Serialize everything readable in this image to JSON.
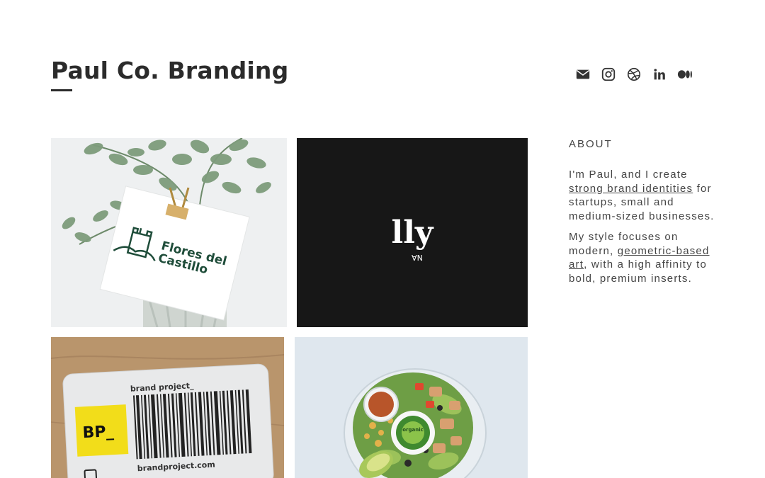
{
  "header": {
    "title": "Paul Co. Branding",
    "social_icons": [
      "envelope-icon",
      "instagram-icon",
      "dribbble-icon",
      "linkedin-icon",
      "medium-icon"
    ]
  },
  "portfolio": {
    "tiles": [
      {
        "name": "flores-del-castillo",
        "text": "Flores del Castillo"
      },
      {
        "name": "lly",
        "text": "lly",
        "subtext": "NA"
      },
      {
        "name": "brand-project",
        "label": "brand project_",
        "badge": "BP_",
        "url": "brandproject.com"
      },
      {
        "name": "salad-bowl",
        "label": "organic"
      }
    ]
  },
  "about": {
    "heading": "ABOUT",
    "p1_before": "I'm Paul, and I create ",
    "p1_link": "strong brand identities",
    "p1_after": " for startups, small and medium-sized businesses.",
    "p2_before": "My style focuses on modern, ",
    "p2_link": "geometric-based art",
    "p2_after": ", with a high affinity to bold, premium inserts."
  },
  "colors": {
    "text": "#2b2b2b",
    "dark_tile": "#171717",
    "kraft": "#b9956c",
    "badge_yellow": "#f2dd1a",
    "green": "#2e7d32"
  }
}
